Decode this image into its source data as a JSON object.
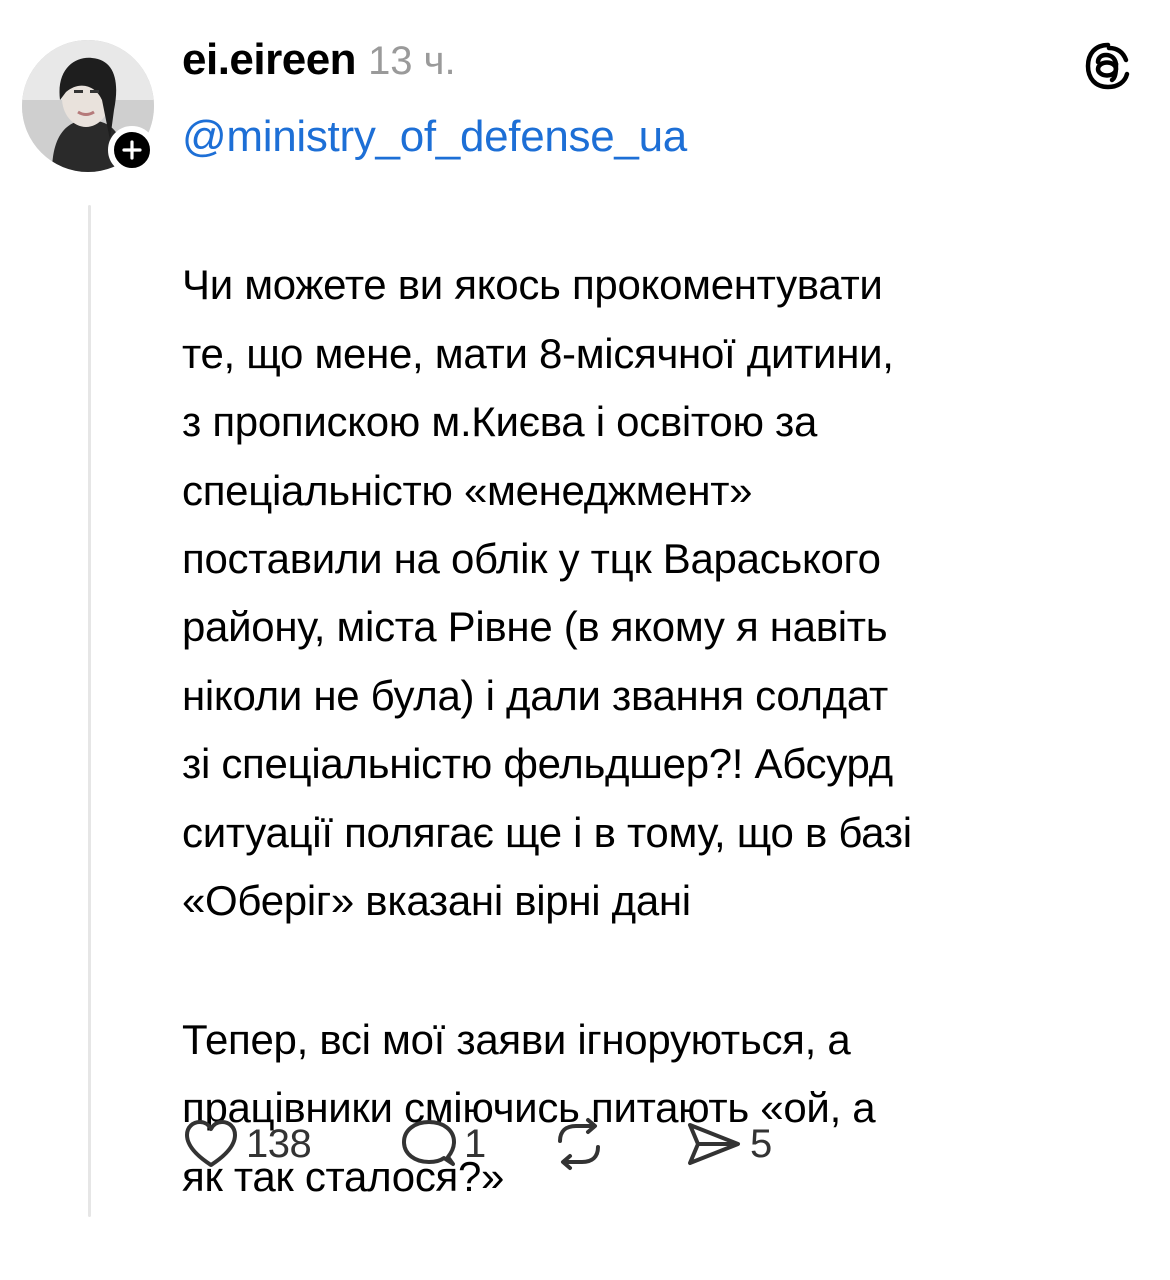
{
  "post": {
    "author": "ei.eireen",
    "time": "13 ч.",
    "mention": "@ministry_of_defense_ua",
    "paragraphs": [
      "Чи можете ви якось прокоментувати\nте, що мене, мати 8-місячної дитини,\nз пропискою м.Києва і освітою за\nспеціальністю «менеджмент»\nпоставили на облік у тцк Вараського\nрайону, міста Рівне (в якому я навіть\nніколи не була) і дали звання солдат\nзі спеціальністю фельдшер?! Абсурд\nситуації полягає ще і в тому, що в базі\n«Оберіг» вказані вірні дані",
      "Тепер, всі мої заяви ігноруються, а\nпрацівники сміючись питають «ой, а\nяк так сталося?»"
    ]
  },
  "actions": {
    "likes": "138",
    "comments": "1",
    "reposts": "",
    "shares": "5"
  },
  "icons": {
    "like": "heart-icon",
    "comment": "comment-bubble-icon",
    "repost": "repost-icon",
    "share": "share-send-icon",
    "app": "threads-logo-icon",
    "follow": "plus-icon"
  },
  "colors": {
    "mention": "#1d6fd6",
    "muted": "#9a9a9a",
    "text": "#000000"
  }
}
